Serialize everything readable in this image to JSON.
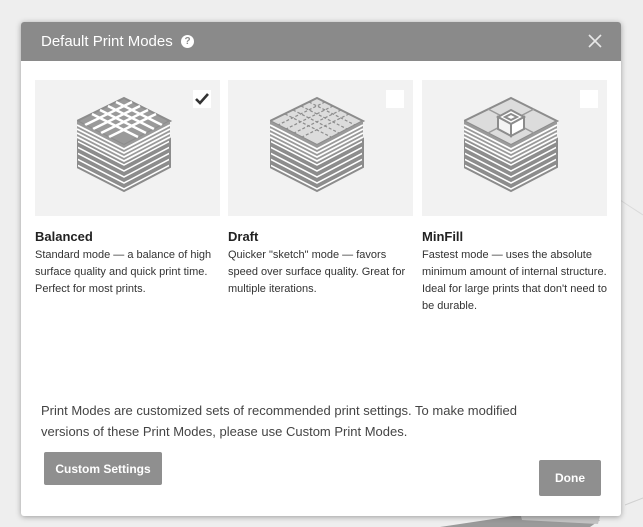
{
  "dialog": {
    "title": "Default Print Modes",
    "help_icon": "question-circle-icon",
    "close_icon": "close-x-icon"
  },
  "modes": [
    {
      "name": "Balanced",
      "description": "Standard mode — a balance of high surface quality and quick print time. Perfect for most prints.",
      "selected": true,
      "illustration": "grid-infill-stack-icon"
    },
    {
      "name": "Draft",
      "description": "Quicker \"sketch\" mode — favors speed over surface quality. Great for multiple iterations.",
      "selected": false,
      "illustration": "dotted-infill-stack-icon"
    },
    {
      "name": "MinFill",
      "description": "Fastest mode — uses the absolute minimum amount of internal structure. Ideal for large prints that don't need to be durable.",
      "selected": false,
      "illustration": "minimal-infill-stack-icon"
    }
  ],
  "footer": {
    "info_text": "Print Modes are customized sets of recommended print settings. To make modified versions of these Print Modes, please use Custom Print Modes.",
    "custom_settings_label": "Custom Settings",
    "done_label": "Done"
  },
  "colors": {
    "titlebar": "#8a8a8a",
    "button": "#8f8f8f",
    "tile_bg": "#f2f2f2"
  }
}
